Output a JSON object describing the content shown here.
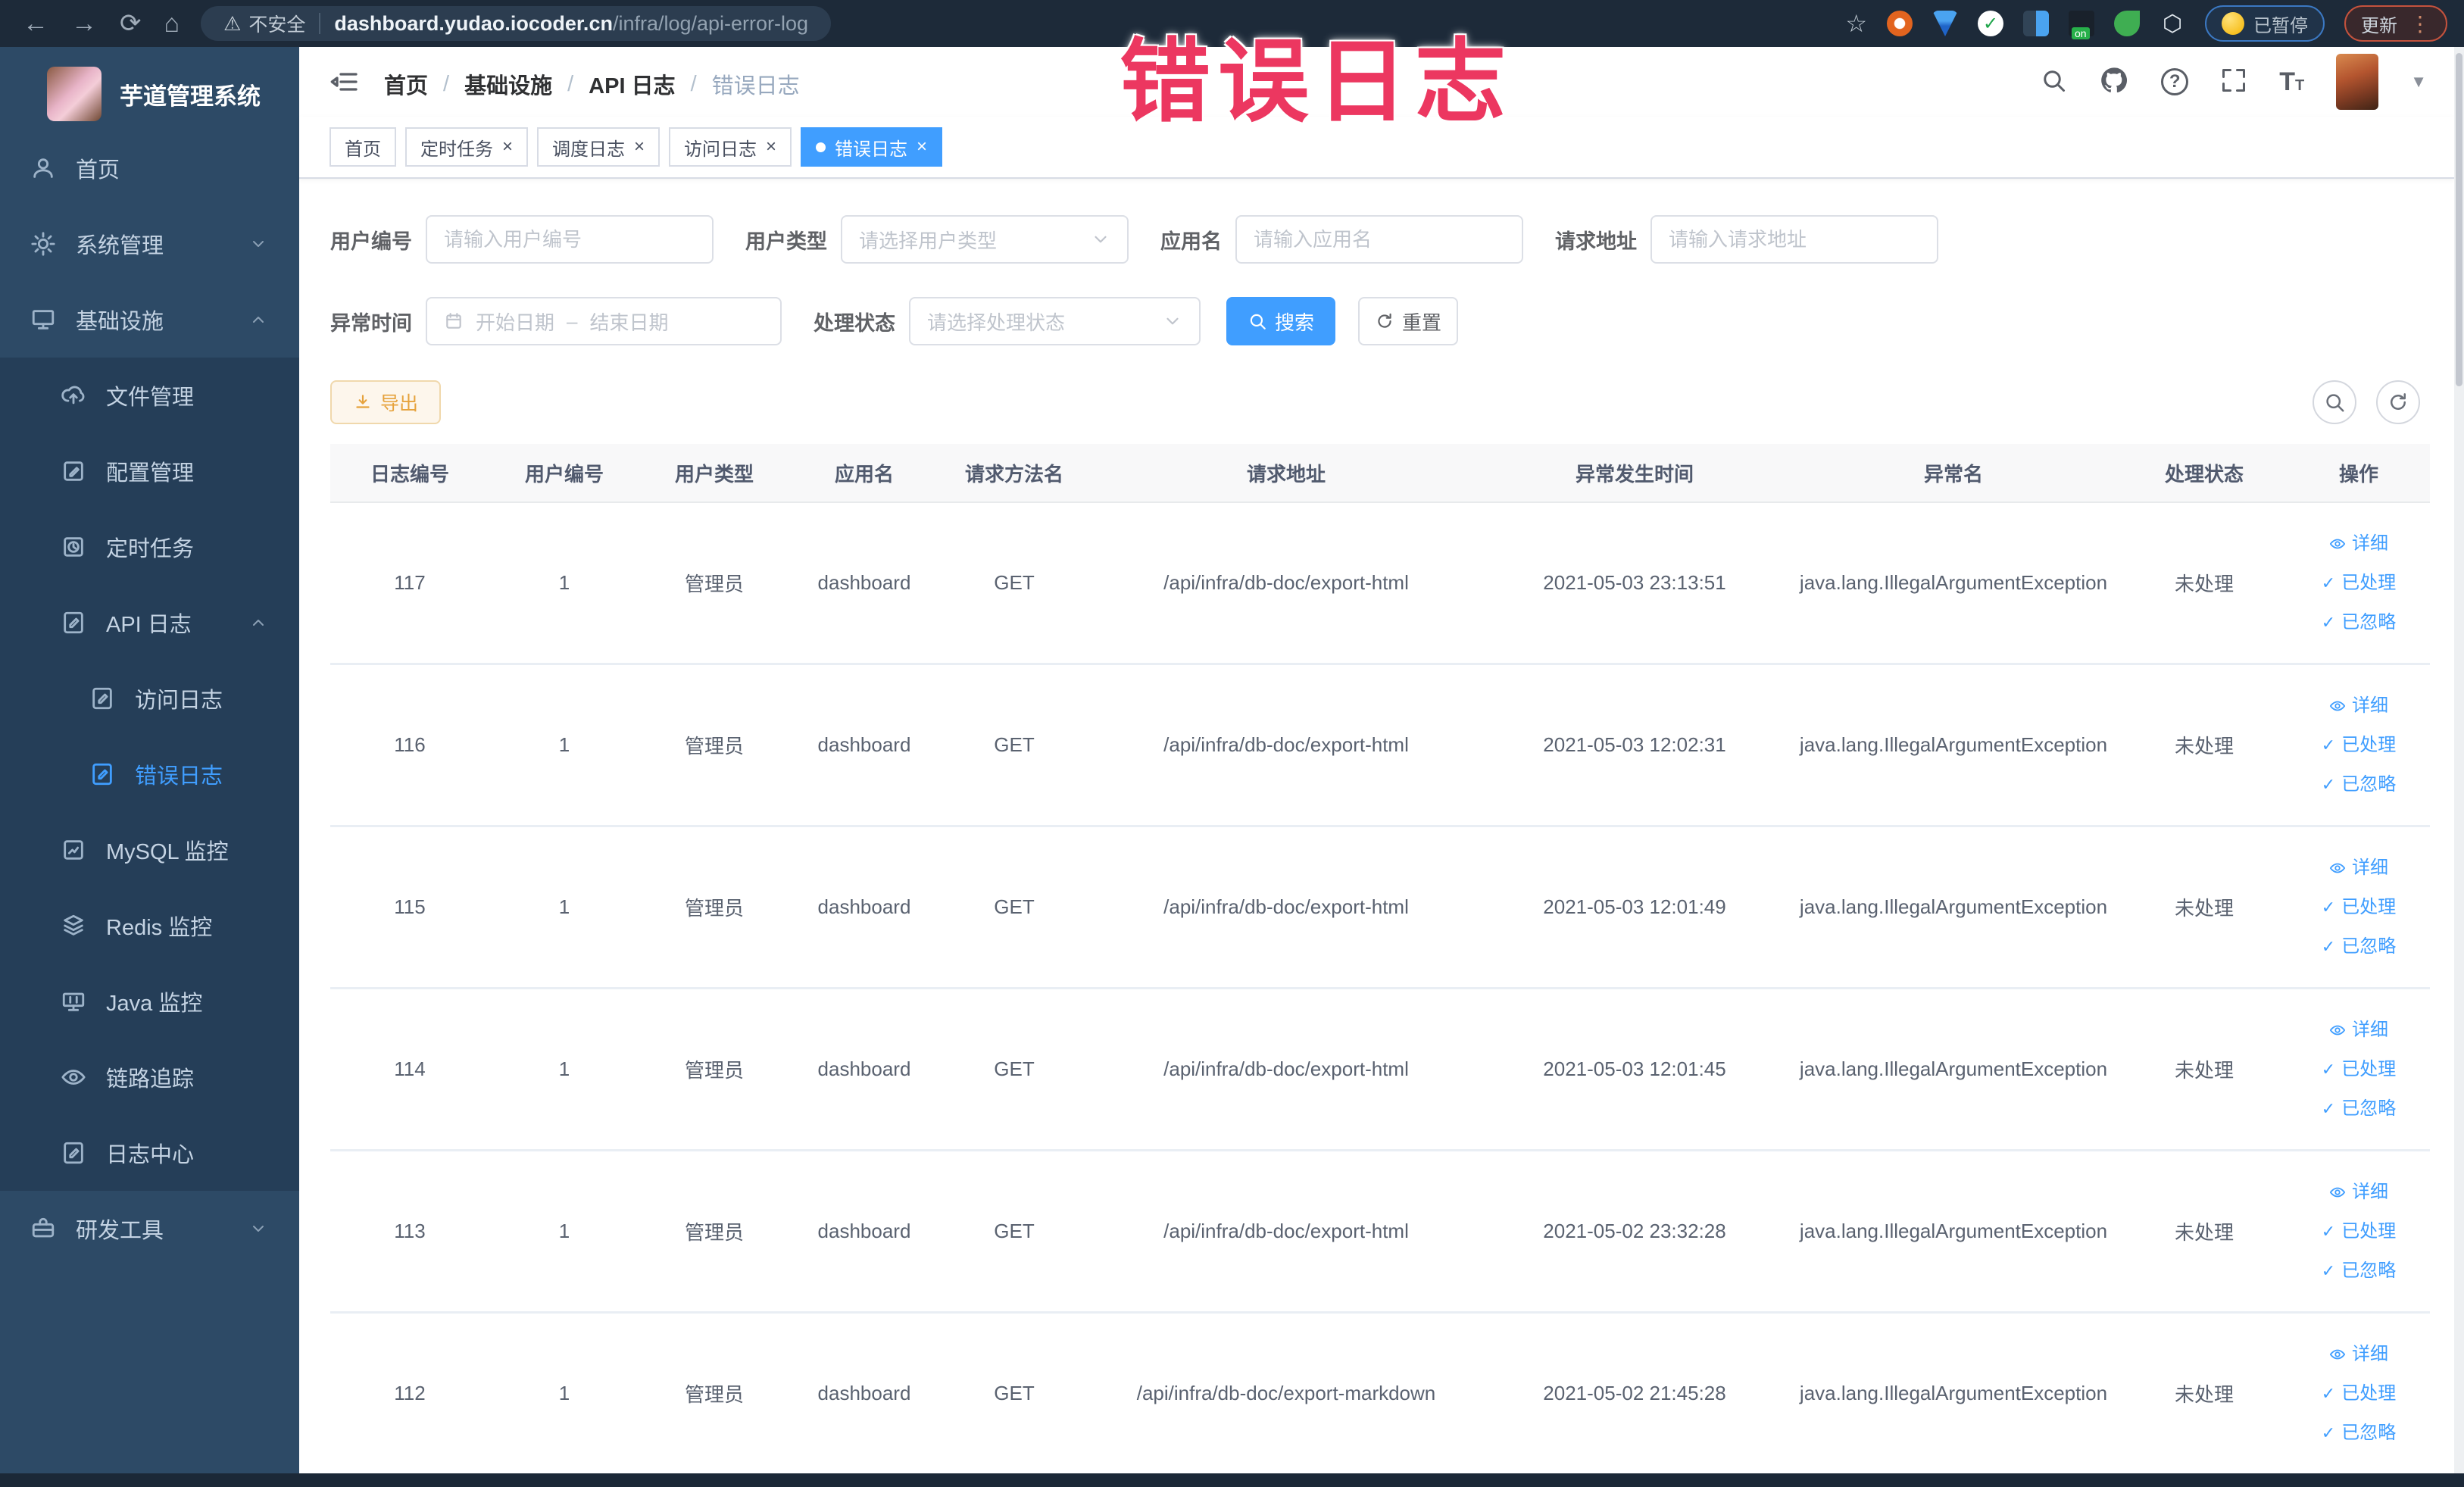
{
  "browser": {
    "security_label": "不安全",
    "url": {
      "domain": "dashboard.yudao.iocoder.cn",
      "path": "/infra/log/api-error-log"
    },
    "paused_badge": "已暂停",
    "update_button": "更新"
  },
  "annotation": {
    "text": "错误日志"
  },
  "sidebar": {
    "title": "芋道管理系统",
    "items": [
      {
        "name": "home",
        "label": "首页",
        "icon": "user-icon",
        "level": 1,
        "sub": false
      },
      {
        "name": "system",
        "label": "系统管理",
        "icon": "gear-icon",
        "level": 1,
        "sub": false,
        "chevron": "down"
      },
      {
        "name": "infra",
        "label": "基础设施",
        "icon": "monitor-icon",
        "level": 1,
        "sub": false,
        "chevron": "up"
      },
      {
        "name": "file",
        "label": "文件管理",
        "icon": "cloud-upload-icon",
        "level": 2,
        "sub": true
      },
      {
        "name": "config",
        "label": "配置管理",
        "icon": "edit-icon",
        "level": 2,
        "sub": true
      },
      {
        "name": "job",
        "label": "定时任务",
        "icon": "clock-icon",
        "level": 2,
        "sub": true
      },
      {
        "name": "api-log",
        "label": "API 日志",
        "icon": "doc-edit-icon",
        "level": 2,
        "sub": true,
        "chevron": "up"
      },
      {
        "name": "access-log",
        "label": "访问日志",
        "icon": "doc-edit-icon",
        "level": 3,
        "sub": true
      },
      {
        "name": "error-log",
        "label": "错误日志",
        "icon": "doc-edit-icon",
        "level": 3,
        "sub": true,
        "active": true
      },
      {
        "name": "mysql",
        "label": "MySQL 监控",
        "icon": "chart-icon",
        "level": 2,
        "sub": true
      },
      {
        "name": "redis",
        "label": "Redis 监控",
        "icon": "layers-icon",
        "level": 2,
        "sub": true
      },
      {
        "name": "java",
        "label": "Java 监控",
        "icon": "java-monitor-icon",
        "level": 2,
        "sub": true
      },
      {
        "name": "trace",
        "label": "链路追踪",
        "icon": "eye-icon",
        "level": 2,
        "sub": true
      },
      {
        "name": "log-center",
        "label": "日志中心",
        "icon": "doc-edit-icon",
        "level": 2,
        "sub": true
      },
      {
        "name": "dev-tools",
        "label": "研发工具",
        "icon": "toolbox-icon",
        "level": 1,
        "sub": false,
        "chevron": "down"
      }
    ]
  },
  "header": {
    "breadcrumb": [
      "首页",
      "基础设施",
      "API 日志",
      "错误日志"
    ]
  },
  "tabs": [
    {
      "label": "首页",
      "closable": false,
      "active": false
    },
    {
      "label": "定时任务",
      "closable": true,
      "active": false
    },
    {
      "label": "调度日志",
      "closable": true,
      "active": false
    },
    {
      "label": "访问日志",
      "closable": true,
      "active": false
    },
    {
      "label": "错误日志",
      "closable": true,
      "active": true
    }
  ],
  "filters": {
    "user_id": {
      "label": "用户编号",
      "placeholder": "请输入用户编号"
    },
    "user_type": {
      "label": "用户类型",
      "placeholder": "请选择用户类型"
    },
    "app_name": {
      "label": "应用名",
      "placeholder": "请输入应用名"
    },
    "request_url": {
      "label": "请求地址",
      "placeholder": "请输入请求地址"
    },
    "exception_time": {
      "label": "异常时间",
      "start_placeholder": "开始日期",
      "separator": "–",
      "end_placeholder": "结束日期"
    },
    "process_status": {
      "label": "处理状态",
      "placeholder": "请选择处理状态"
    },
    "search_button": "搜索",
    "reset_button": "重置"
  },
  "toolbar": {
    "export_button": "导出"
  },
  "table": {
    "columns": [
      "日志编号",
      "用户编号",
      "用户类型",
      "应用名",
      "请求方法名",
      "请求地址",
      "异常发生时间",
      "异常名",
      "处理状态",
      "操作"
    ],
    "actions": [
      "详细",
      "已处理",
      "已忽略"
    ],
    "rows": [
      {
        "id": "117",
        "user_id": "1",
        "user_type": "管理员",
        "app": "dashboard",
        "method": "GET",
        "url": "/api/infra/db-doc/export-html",
        "time": "2021-05-03 23:13:51",
        "exception": "java.lang.IllegalArgumentException",
        "status": "未处理"
      },
      {
        "id": "116",
        "user_id": "1",
        "user_type": "管理员",
        "app": "dashboard",
        "method": "GET",
        "url": "/api/infra/db-doc/export-html",
        "time": "2021-05-03 12:02:31",
        "exception": "java.lang.IllegalArgumentException",
        "status": "未处理"
      },
      {
        "id": "115",
        "user_id": "1",
        "user_type": "管理员",
        "app": "dashboard",
        "method": "GET",
        "url": "/api/infra/db-doc/export-html",
        "time": "2021-05-03 12:01:49",
        "exception": "java.lang.IllegalArgumentException",
        "status": "未处理"
      },
      {
        "id": "114",
        "user_id": "1",
        "user_type": "管理员",
        "app": "dashboard",
        "method": "GET",
        "url": "/api/infra/db-doc/export-html",
        "time": "2021-05-03 12:01:45",
        "exception": "java.lang.IllegalArgumentException",
        "status": "未处理"
      },
      {
        "id": "113",
        "user_id": "1",
        "user_type": "管理员",
        "app": "dashboard",
        "method": "GET",
        "url": "/api/infra/db-doc/export-html",
        "time": "2021-05-02 23:32:28",
        "exception": "java.lang.IllegalArgumentException",
        "status": "未处理"
      },
      {
        "id": "112",
        "user_id": "1",
        "user_type": "管理员",
        "app": "dashboard",
        "method": "GET",
        "url": "/api/infra/db-doc/export-markdown",
        "time": "2021-05-02 21:45:28",
        "exception": "java.lang.IllegalArgumentException",
        "status": "未处理"
      }
    ]
  },
  "colors": {
    "accent": "#409eff",
    "warning": "#e6a23c",
    "annotation": "#ec3760",
    "sidebar_bg": "#2d4a66",
    "sidebar_sub_bg": "#253e58"
  }
}
